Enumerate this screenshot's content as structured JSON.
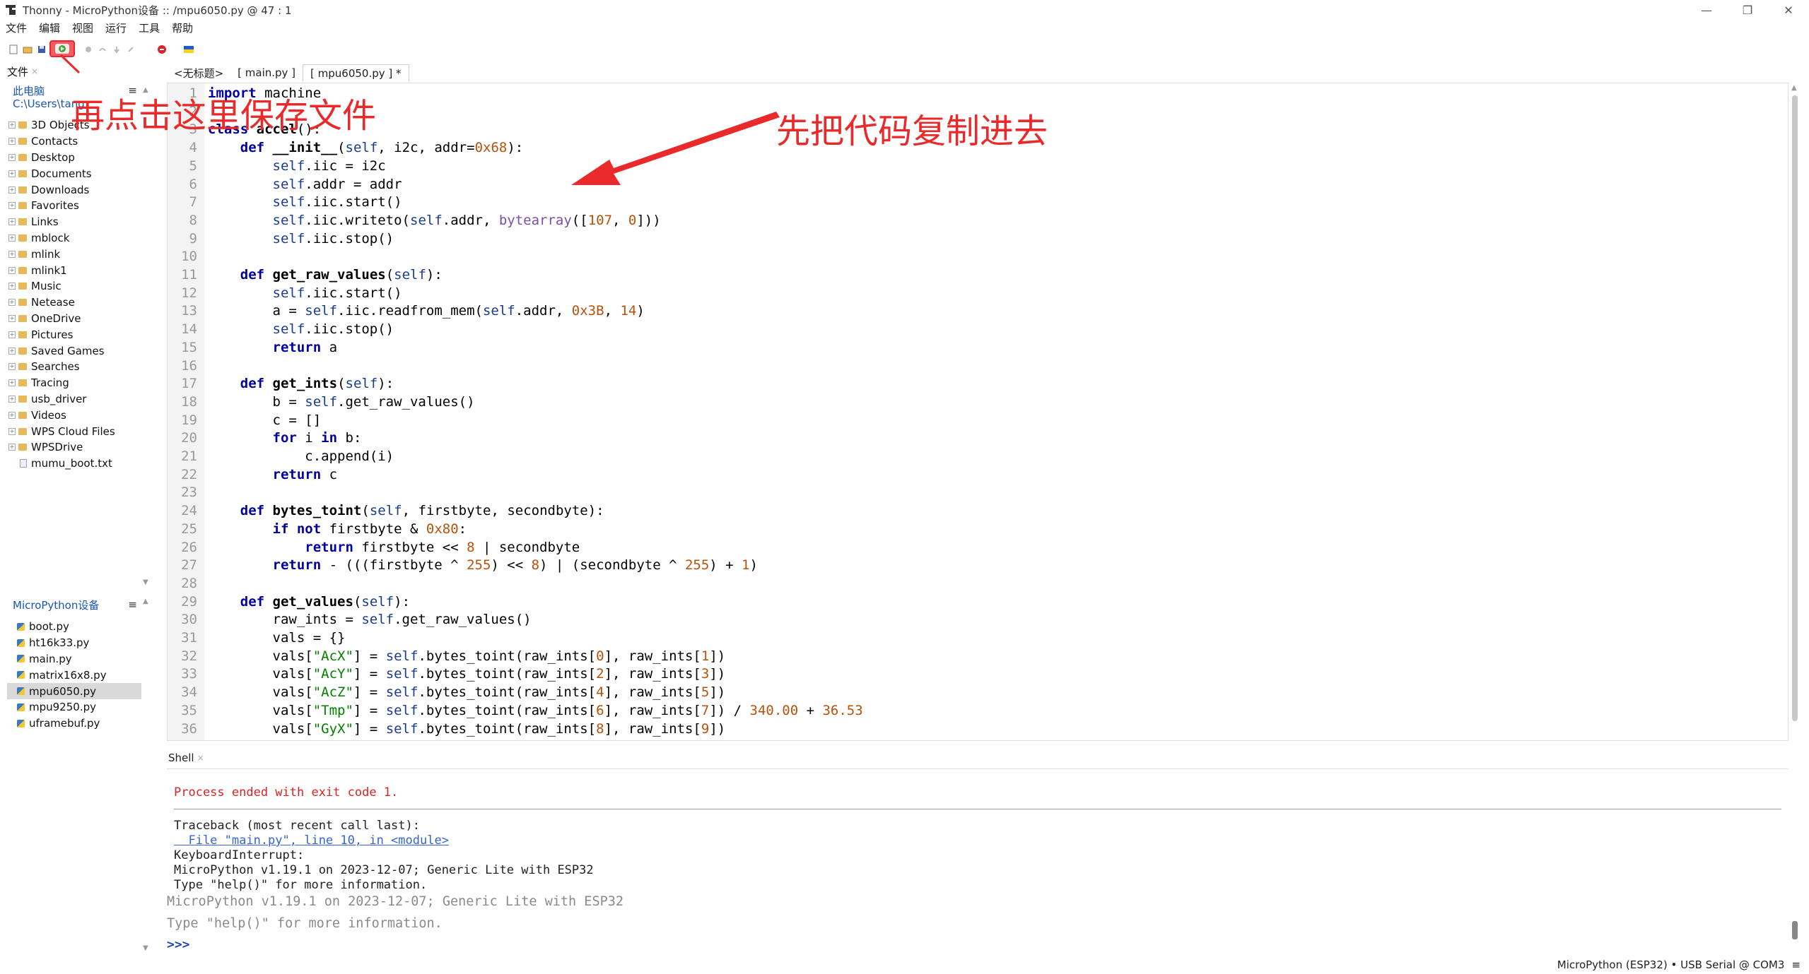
{
  "window": {
    "title": "Thonny  -  MicroPython设备 :: /mpu6050.py  @  47 : 1",
    "controls": [
      "—",
      "❐",
      "✕"
    ]
  },
  "menu": [
    "文件",
    "编辑",
    "视图",
    "运行",
    "工具",
    "帮助"
  ],
  "files_panel": {
    "tab_label": "文件",
    "header": "此电脑",
    "path": "C:\\Users\\tang",
    "items": [
      {
        "label": "3D Objects",
        "type": "folder"
      },
      {
        "label": "Contacts",
        "type": "folder"
      },
      {
        "label": "Desktop",
        "type": "folder"
      },
      {
        "label": "Documents",
        "type": "folder"
      },
      {
        "label": "Downloads",
        "type": "folder"
      },
      {
        "label": "Favorites",
        "type": "folder"
      },
      {
        "label": "Links",
        "type": "folder"
      },
      {
        "label": "mblock",
        "type": "folder"
      },
      {
        "label": "mlink",
        "type": "folder"
      },
      {
        "label": "mlink1",
        "type": "folder"
      },
      {
        "label": "Music",
        "type": "folder"
      },
      {
        "label": "Netease",
        "type": "folder"
      },
      {
        "label": "OneDrive",
        "type": "folder"
      },
      {
        "label": "Pictures",
        "type": "folder"
      },
      {
        "label": "Saved Games",
        "type": "folder"
      },
      {
        "label": "Searches",
        "type": "folder"
      },
      {
        "label": "Tracing",
        "type": "folder"
      },
      {
        "label": "usb_driver",
        "type": "folder"
      },
      {
        "label": "Videos",
        "type": "folder"
      },
      {
        "label": "WPS Cloud Files",
        "type": "folder"
      },
      {
        "label": "WPSDrive",
        "type": "folder"
      },
      {
        "label": "mumu_boot.txt",
        "type": "file"
      }
    ]
  },
  "device_panel": {
    "header": "MicroPython设备",
    "items": [
      "boot.py",
      "ht16k33.py",
      "main.py",
      "matrix16x8.py",
      "mpu6050.py",
      "mpu9250.py",
      "uframebuf.py"
    ],
    "selected": "mpu6050.py"
  },
  "editor": {
    "tabs": [
      "<无标题>",
      "[ main.py ]",
      "[ mpu6050.py ] *"
    ],
    "active_tab": "[ mpu6050.py ] *",
    "lines": [
      "import machine",
      "",
      "class accel():",
      "    def __init__(self, i2c, addr=0x68):",
      "        self.iic = i2c",
      "        self.addr = addr",
      "        self.iic.start()",
      "        self.iic.writeto(self.addr, bytearray([107, 0]))",
      "        self.iic.stop()",
      "",
      "    def get_raw_values(self):",
      "        self.iic.start()",
      "        a = self.iic.readfrom_mem(self.addr, 0x3B, 14)",
      "        self.iic.stop()",
      "        return a",
      "",
      "    def get_ints(self):",
      "        b = self.get_raw_values()",
      "        c = []",
      "        for i in b:",
      "            c.append(i)",
      "        return c",
      "",
      "    def bytes_toint(self, firstbyte, secondbyte):",
      "        if not firstbyte & 0x80:",
      "            return firstbyte << 8 | secondbyte",
      "        return - (((firstbyte ^ 255) << 8) | (secondbyte ^ 255) + 1)",
      "",
      "    def get_values(self):",
      "        raw_ints = self.get_raw_values()",
      "        vals = {}",
      "        vals[\"AcX\"] = self.bytes_toint(raw_ints[0], raw_ints[1])",
      "        vals[\"AcY\"] = self.bytes_toint(raw_ints[2], raw_ints[3])",
      "        vals[\"AcZ\"] = self.bytes_toint(raw_ints[4], raw_ints[5])",
      "        vals[\"Tmp\"] = self.bytes_toint(raw_ints[6], raw_ints[7]) / 340.00 + 36.53",
      "        vals[\"GyX\"] = self.bytes_toint(raw_ints[8], raw_ints[9])"
    ]
  },
  "shell": {
    "tab_label": "Shell",
    "error_line": "Process ended with exit code 1.",
    "traceback": [
      "Traceback (most recent call last):",
      "  File \"main.py\", line 10, in <module>",
      "KeyboardInterrupt:",
      "MicroPython v1.19.1 on 2023-12-07; Generic Lite with ESP32",
      "Type \"help()\" for more information."
    ],
    "banner": [
      "MicroPython v1.19.1 on 2023-12-07; Generic Lite with ESP32",
      "Type \"help()\" for more information."
    ],
    "prompt": ">>>"
  },
  "status": {
    "interpreter": "MicroPython (ESP32)  •  USB Serial @ COM3",
    "menu_glyph": "≡"
  },
  "annotations": {
    "save_hint": "再点击这里保存文件",
    "copy_hint": "先把代码复制进去"
  },
  "colors": {
    "annotation": "#ea2a2a",
    "keyword": "#0000a0",
    "number": "#b8520a",
    "string": "#007f00",
    "self": "#1a3c8c",
    "builtin": "#7b4ea8",
    "shell_error": "#d22222"
  }
}
